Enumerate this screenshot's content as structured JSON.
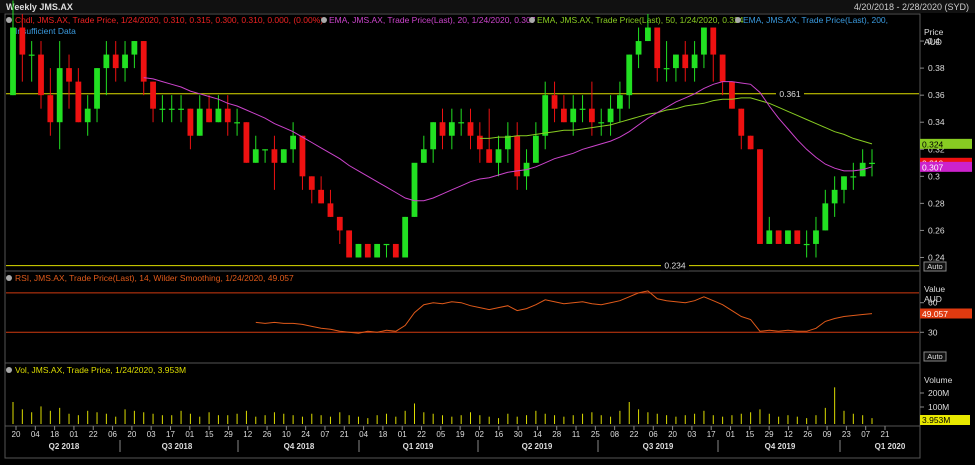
{
  "header": {
    "title": "Weekly JMS.AX",
    "date_range": "4/20/2018 - 2/28/2020 (SYD)"
  },
  "legend": {
    "candle": "Cndl, JMS.AX, Trade Price, 1/24/2020, 0.310, 0.315, 0.300, 0.310, 0.000, (0.00%)",
    "ema20": "EMA, JMS.AX, Trade Price(Last), 20, 1/24/2020, 0.307",
    "ema50": "EMA, JMS.AX, Trade Price(Last), 50, 1/24/2020, 0.324",
    "ema200": "EMA, JMS.AX, Trade Price(Last), 200,",
    "insufficient": "Insufficient Data",
    "rsi": "RSI, JMS.AX, Trade Price(Last), 14, Wilder Smoothing, 1/24/2020, 49.057",
    "vol": "Vol, JMS.AX, Trade Price, 1/24/2020, 3.953M"
  },
  "price_axis": {
    "title": "Price",
    "unit": "AUD",
    "auto": "Auto"
  },
  "rsi_axis": {
    "title": "Value",
    "unit": "AUD",
    "auto": "Auto"
  },
  "vol_axis": {
    "title": "Volume"
  },
  "colors": {
    "up": "#22e022",
    "down": "#ee1111",
    "ema20": "#cc44cc",
    "ema50": "#88cc22",
    "rsi": "#e05a1a",
    "hline": "#dddd00",
    "rsi_level": "#d03a10"
  },
  "chart_data": [
    {
      "type": "candlestick",
      "title": "Weekly JMS.AX",
      "ylabel": "Price AUD",
      "ylim": [
        0.23,
        0.42
      ],
      "yticks": [
        0.24,
        0.26,
        0.28,
        0.3,
        0.32,
        0.34,
        0.36,
        0.38,
        0.4
      ],
      "horizontal_lines": [
        0.361,
        0.234
      ],
      "last_values": {
        "ema50": "0.324",
        "close": "0.310",
        "ema20": "0.307"
      },
      "ohlc": [
        [
          0.36,
          0.43,
          0.36,
          0.41
        ],
        [
          0.41,
          0.42,
          0.37,
          0.39
        ],
        [
          0.39,
          0.4,
          0.37,
          0.39
        ],
        [
          0.39,
          0.4,
          0.35,
          0.36
        ],
        [
          0.36,
          0.38,
          0.33,
          0.34
        ],
        [
          0.34,
          0.4,
          0.32,
          0.38
        ],
        [
          0.38,
          0.39,
          0.35,
          0.37
        ],
        [
          0.37,
          0.38,
          0.34,
          0.34
        ],
        [
          0.34,
          0.36,
          0.33,
          0.35
        ],
        [
          0.35,
          0.38,
          0.34,
          0.38
        ],
        [
          0.38,
          0.4,
          0.36,
          0.39
        ],
        [
          0.39,
          0.4,
          0.37,
          0.38
        ],
        [
          0.38,
          0.4,
          0.37,
          0.39
        ],
        [
          0.39,
          0.4,
          0.38,
          0.4
        ],
        [
          0.4,
          0.4,
          0.36,
          0.37
        ],
        [
          0.37,
          0.37,
          0.34,
          0.35
        ],
        [
          0.35,
          0.36,
          0.34,
          0.35
        ],
        [
          0.35,
          0.36,
          0.34,
          0.35
        ],
        [
          0.35,
          0.36,
          0.34,
          0.35
        ],
        [
          0.35,
          0.35,
          0.32,
          0.33
        ],
        [
          0.33,
          0.36,
          0.33,
          0.35
        ],
        [
          0.35,
          0.36,
          0.34,
          0.34
        ],
        [
          0.34,
          0.36,
          0.34,
          0.35
        ],
        [
          0.35,
          0.36,
          0.33,
          0.34
        ],
        [
          0.34,
          0.35,
          0.33,
          0.34
        ],
        [
          0.34,
          0.34,
          0.31,
          0.31
        ],
        [
          0.31,
          0.33,
          0.31,
          0.32
        ],
        [
          0.32,
          0.32,
          0.31,
          0.32
        ],
        [
          0.32,
          0.33,
          0.29,
          0.31
        ],
        [
          0.31,
          0.32,
          0.31,
          0.32
        ],
        [
          0.32,
          0.34,
          0.31,
          0.33
        ],
        [
          0.33,
          0.33,
          0.29,
          0.3
        ],
        [
          0.3,
          0.3,
          0.28,
          0.29
        ],
        [
          0.29,
          0.3,
          0.28,
          0.28
        ],
        [
          0.28,
          0.29,
          0.27,
          0.27
        ],
        [
          0.27,
          0.27,
          0.25,
          0.26
        ],
        [
          0.26,
          0.26,
          0.24,
          0.24
        ],
        [
          0.24,
          0.25,
          0.24,
          0.25
        ],
        [
          0.25,
          0.25,
          0.24,
          0.24
        ],
        [
          0.24,
          0.25,
          0.24,
          0.25
        ],
        [
          0.25,
          0.25,
          0.24,
          0.25
        ],
        [
          0.25,
          0.25,
          0.24,
          0.24
        ],
        [
          0.24,
          0.27,
          0.24,
          0.27
        ],
        [
          0.27,
          0.3,
          0.27,
          0.31
        ],
        [
          0.31,
          0.33,
          0.31,
          0.32
        ],
        [
          0.32,
          0.34,
          0.31,
          0.34
        ],
        [
          0.34,
          0.35,
          0.32,
          0.33
        ],
        [
          0.33,
          0.35,
          0.32,
          0.34
        ],
        [
          0.34,
          0.35,
          0.33,
          0.34
        ],
        [
          0.34,
          0.35,
          0.32,
          0.33
        ],
        [
          0.33,
          0.34,
          0.31,
          0.32
        ],
        [
          0.32,
          0.35,
          0.31,
          0.31
        ],
        [
          0.31,
          0.33,
          0.3,
          0.32
        ],
        [
          0.32,
          0.34,
          0.31,
          0.33
        ],
        [
          0.33,
          0.34,
          0.29,
          0.3
        ],
        [
          0.3,
          0.32,
          0.29,
          0.31
        ],
        [
          0.31,
          0.34,
          0.31,
          0.33
        ],
        [
          0.33,
          0.37,
          0.32,
          0.36
        ],
        [
          0.36,
          0.37,
          0.34,
          0.35
        ],
        [
          0.35,
          0.36,
          0.34,
          0.34
        ],
        [
          0.34,
          0.36,
          0.33,
          0.35
        ],
        [
          0.35,
          0.36,
          0.34,
          0.35
        ],
        [
          0.35,
          0.37,
          0.33,
          0.34
        ],
        [
          0.34,
          0.35,
          0.33,
          0.34
        ],
        [
          0.34,
          0.36,
          0.33,
          0.35
        ],
        [
          0.35,
          0.37,
          0.34,
          0.36
        ],
        [
          0.36,
          0.39,
          0.35,
          0.39
        ],
        [
          0.39,
          0.41,
          0.38,
          0.4
        ],
        [
          0.4,
          0.42,
          0.4,
          0.41
        ],
        [
          0.41,
          0.41,
          0.37,
          0.38
        ],
        [
          0.38,
          0.4,
          0.37,
          0.38
        ],
        [
          0.38,
          0.39,
          0.37,
          0.39
        ],
        [
          0.39,
          0.4,
          0.37,
          0.38
        ],
        [
          0.38,
          0.4,
          0.37,
          0.39
        ],
        [
          0.39,
          0.41,
          0.38,
          0.41
        ],
        [
          0.41,
          0.41,
          0.37,
          0.39
        ],
        [
          0.39,
          0.39,
          0.36,
          0.37
        ],
        [
          0.37,
          0.37,
          0.35,
          0.35
        ],
        [
          0.35,
          0.35,
          0.32,
          0.33
        ],
        [
          0.33,
          0.33,
          0.32,
          0.32
        ],
        [
          0.32,
          0.32,
          0.25,
          0.25
        ],
        [
          0.25,
          0.27,
          0.25,
          0.26
        ],
        [
          0.26,
          0.26,
          0.25,
          0.25
        ],
        [
          0.25,
          0.26,
          0.25,
          0.26
        ],
        [
          0.26,
          0.26,
          0.25,
          0.25
        ],
        [
          0.25,
          0.26,
          0.24,
          0.25
        ],
        [
          0.25,
          0.27,
          0.24,
          0.26
        ],
        [
          0.26,
          0.29,
          0.26,
          0.28
        ],
        [
          0.28,
          0.3,
          0.27,
          0.29
        ],
        [
          0.29,
          0.3,
          0.28,
          0.3
        ],
        [
          0.3,
          0.31,
          0.29,
          0.3
        ],
        [
          0.3,
          0.32,
          0.3,
          0.31
        ],
        [
          0.31,
          0.32,
          0.3,
          0.31
        ]
      ],
      "ema20": [
        null,
        null,
        null,
        null,
        null,
        null,
        null,
        null,
        null,
        null,
        null,
        null,
        null,
        null,
        0.373,
        0.372,
        0.37,
        0.368,
        0.366,
        0.363,
        0.361,
        0.359,
        0.357,
        0.354,
        0.352,
        0.349,
        0.346,
        0.343,
        0.339,
        0.336,
        0.333,
        0.329,
        0.325,
        0.321,
        0.317,
        0.313,
        0.308,
        0.304,
        0.3,
        0.296,
        0.292,
        0.288,
        0.284,
        0.282,
        0.282,
        0.284,
        0.287,
        0.29,
        0.293,
        0.296,
        0.298,
        0.299,
        0.301,
        0.303,
        0.304,
        0.305,
        0.307,
        0.31,
        0.313,
        0.315,
        0.317,
        0.32,
        0.322,
        0.324,
        0.326,
        0.329,
        0.333,
        0.338,
        0.343,
        0.347,
        0.351,
        0.355,
        0.358,
        0.361,
        0.365,
        0.368,
        0.37,
        0.37,
        0.369,
        0.368,
        0.362,
        0.352,
        0.343,
        0.335,
        0.327,
        0.32,
        0.314,
        0.309,
        0.306,
        0.304,
        0.304,
        0.305,
        0.307
      ],
      "ema50": [
        null,
        null,
        null,
        null,
        null,
        null,
        null,
        null,
        null,
        null,
        null,
        null,
        null,
        null,
        null,
        null,
        null,
        null,
        null,
        null,
        null,
        null,
        null,
        null,
        null,
        null,
        null,
        null,
        null,
        null,
        null,
        null,
        null,
        null,
        null,
        null,
        null,
        null,
        null,
        null,
        null,
        null,
        null,
        null,
        null,
        null,
        null,
        null,
        null,
        null,
        0.328,
        0.328,
        0.329,
        0.329,
        0.33,
        0.33,
        0.331,
        0.332,
        0.333,
        0.334,
        0.334,
        0.335,
        0.336,
        0.337,
        0.338,
        0.34,
        0.342,
        0.344,
        0.346,
        0.347,
        0.349,
        0.35,
        0.352,
        0.353,
        0.354,
        0.356,
        0.357,
        0.357,
        0.358,
        0.358,
        0.356,
        0.354,
        0.351,
        0.348,
        0.345,
        0.342,
        0.339,
        0.336,
        0.333,
        0.331,
        0.328,
        0.326,
        0.324
      ]
    },
    {
      "type": "line",
      "title": "RSI",
      "ylim": [
        0,
        100
      ],
      "yticks": [
        30,
        60
      ],
      "levels": [
        70,
        30
      ],
      "last_value": "49.057",
      "values": [
        null,
        null,
        null,
        null,
        null,
        null,
        null,
        null,
        null,
        null,
        null,
        null,
        null,
        null,
        null,
        null,
        null,
        null,
        null,
        null,
        null,
        null,
        null,
        null,
        null,
        null,
        40,
        39,
        40,
        39,
        39,
        38,
        36,
        34,
        33,
        31,
        30,
        29,
        31,
        30,
        32,
        31,
        37,
        50,
        58,
        60,
        59,
        61,
        60,
        57,
        55,
        53,
        55,
        57,
        52,
        54,
        58,
        63,
        61,
        59,
        60,
        61,
        59,
        58,
        60,
        62,
        66,
        70,
        72,
        64,
        62,
        61,
        60,
        62,
        66,
        62,
        58,
        52,
        46,
        43,
        31,
        32,
        31,
        32,
        31,
        31,
        34,
        41,
        44,
        46,
        47,
        48,
        49
      ]
    },
    {
      "type": "bar",
      "title": "Volume",
      "yticks": [
        "100M",
        "200M"
      ],
      "last_value": "3.953M",
      "values": [
        1.5,
        1.0,
        0.8,
        1.2,
        0.9,
        1.1,
        0.7,
        0.6,
        0.9,
        0.8,
        0.7,
        0.5,
        1.0,
        0.9,
        0.8,
        0.7,
        0.6,
        0.6,
        0.9,
        0.7,
        0.5,
        0.8,
        0.6,
        0.6,
        0.7,
        0.9,
        0.5,
        0.6,
        0.8,
        0.7,
        0.6,
        0.5,
        0.7,
        0.6,
        0.5,
        0.8,
        0.6,
        0.5,
        0.4,
        0.6,
        0.7,
        0.5,
        0.9,
        1.4,
        0.8,
        0.7,
        0.6,
        0.5,
        0.6,
        0.8,
        0.6,
        0.5,
        0.4,
        0.7,
        0.5,
        0.6,
        0.9,
        0.7,
        0.6,
        0.5,
        0.6,
        0.7,
        0.8,
        0.6,
        0.5,
        0.9,
        1.5,
        1.0,
        0.8,
        0.7,
        0.6,
        0.5,
        0.6,
        0.7,
        0.9,
        0.6,
        0.5,
        0.6,
        0.7,
        0.8,
        1.0,
        0.7,
        0.5,
        0.6,
        0.5,
        0.4,
        0.6,
        1.1,
        2.5,
        0.9,
        0.7,
        0.6,
        0.4
      ]
    }
  ],
  "x_axis": {
    "week_labels": [
      "20",
      "04",
      "18",
      "01",
      "22",
      "06",
      "20",
      "03",
      "17",
      "01",
      "15",
      "29",
      "12",
      "26",
      "10",
      "24",
      "07",
      "21",
      "04",
      "18",
      "01",
      "22",
      "05",
      "19",
      "02",
      "16",
      "30",
      "14",
      "28",
      "11",
      "25",
      "08",
      "22",
      "06",
      "20",
      "03",
      "17",
      "01",
      "15",
      "29",
      "12",
      "26",
      "09",
      "23",
      "07",
      "21"
    ],
    "quarter_labels": [
      "Q2 2018",
      "Q3 2018",
      "Q4 2018",
      "Q1 2019",
      "Q2 2019",
      "Q3 2019",
      "Q4 2019",
      "Q1 2020"
    ]
  }
}
